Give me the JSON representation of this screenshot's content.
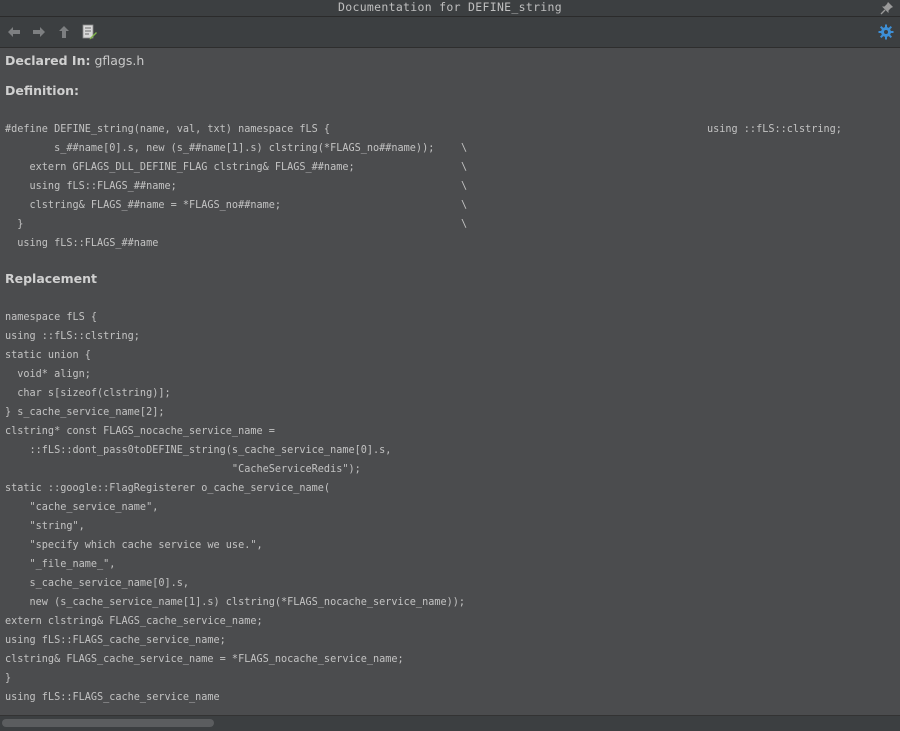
{
  "window": {
    "title": "Documentation for DEFINE_string"
  },
  "toolbar": {
    "back_icon": "arrow-left-icon",
    "forward_icon": "arrow-right-icon",
    "up_icon": "arrow-up-icon",
    "edit_source_icon": "edit-source-icon",
    "settings_icon": "gear-icon"
  },
  "doc": {
    "declared_label": "Declared In:",
    "declared_file": "gflags.h",
    "definition_heading": "Definition:",
    "definition_lines": [
      "#define DEFINE_string(name, val, txt) namespace fLS {",
      "        s_##name[0].s, new (s_##name[1].s) clstring(*FLAGS_no##name));",
      "    extern GFLAGS_DLL_DEFINE_FLAG clstring& FLAGS_##name;",
      "    using fLS::FLAGS_##name;",
      "    clstring& FLAGS_##name = *FLAGS_no##name;",
      "  }",
      "  using fLS::FLAGS_##name"
    ],
    "definition_trailing": {
      "first_line_tail": "using ::fLS::clstring;",
      "continuation": "\\"
    },
    "replacement_heading": "Replacement",
    "replacement_lines": [
      "namespace fLS {",
      "using ::fLS::clstring;",
      "static union {",
      "  void* align;",
      "  char s[sizeof(clstring)];",
      "} s_cache_service_name[2];",
      "clstring* const FLAGS_nocache_service_name =",
      "    ::fLS::dont_pass0toDEFINE_string(s_cache_service_name[0].s,",
      "                                     \"CacheServiceRedis\");",
      "static ::google::FlagRegisterer o_cache_service_name(",
      "    \"cache_service_name\",",
      "    \"string\",",
      "    \"specify which cache service we use.\",",
      "    \"_file_name_\",",
      "    s_cache_service_name[0].s,",
      "    new (s_cache_service_name[1].s) clstring(*FLAGS_nocache_service_name));",
      "extern clstring& FLAGS_cache_service_name;",
      "using fLS::FLAGS_cache_service_name;",
      "clstring& FLAGS_cache_service_name = *FLAGS_nocache_service_name;",
      "}",
      "using fLS::FLAGS_cache_service_name"
    ]
  },
  "colors": {
    "background": "#4b4c4e",
    "toolbar": "#3c3f41",
    "accent_gear": "#3d8fd6"
  }
}
